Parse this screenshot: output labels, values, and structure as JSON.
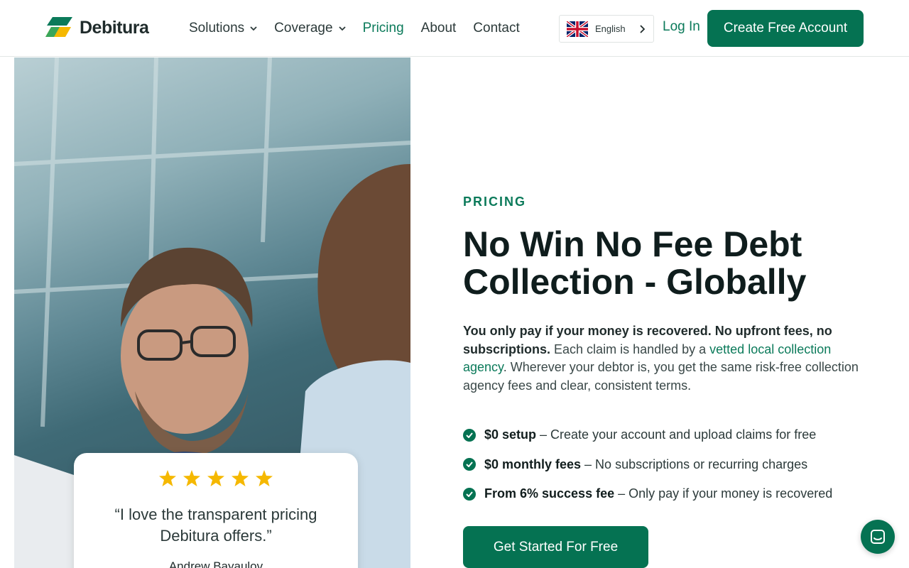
{
  "brand": {
    "name": "Debitura"
  },
  "nav": {
    "items": [
      {
        "label": "Solutions",
        "dropdown": true
      },
      {
        "label": "Coverage",
        "dropdown": true
      },
      {
        "label": "Pricing",
        "active": true
      },
      {
        "label": "About"
      },
      {
        "label": "Contact"
      }
    ],
    "language": "English",
    "login": "Log In",
    "cta": "Create Free Account"
  },
  "review": {
    "rating": 5,
    "quote": "“I love the transparent pricing Debitura offers.”",
    "author": "Andrew Bayaulov"
  },
  "hero": {
    "eyebrow": "PRICING",
    "title": "No Win No Fee Debt Collection - Globally",
    "desc_bold": "You only pay if your money is recovered. No upfront fees, no subscriptions.",
    "desc_mid": " Each claim is handled by a ",
    "desc_link": "vetted local collection agency",
    "desc_end": ". Wherever your debtor is, you get the same risk-free collection agency fees and clear, consistent terms.",
    "features": [
      {
        "bold": "$0 setup",
        "text": " – Create your account and upload claims for free"
      },
      {
        "bold": "$0 monthly fees",
        "text": " – No subscriptions or recurring charges"
      },
      {
        "bold": "From 6% success fee",
        "text": " – Only pay if your money is recovered"
      }
    ],
    "cta": "Get Started For Free"
  },
  "colors": {
    "brand_green": "#057252",
    "accent_green": "#0b7a5a",
    "star": "#f5b800"
  }
}
